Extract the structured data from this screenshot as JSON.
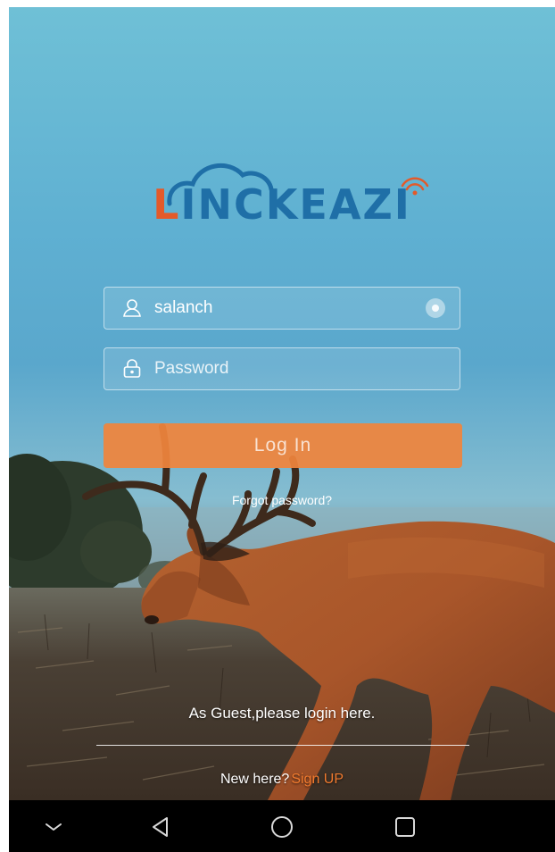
{
  "logo": {
    "text_first": "L",
    "text_rest": "INCKEAZI"
  },
  "login_form": {
    "username_value": "salanch",
    "password_placeholder": "Password",
    "login_label": "Log  In",
    "forgot_label": "Forgot password?"
  },
  "guest": {
    "label": "As Guest,please login here."
  },
  "signup": {
    "prompt": "New here?",
    "link_label": "Sign UP"
  },
  "navbar": {
    "items": [
      "back-icon",
      "back-triangle-icon",
      "home-circle-icon",
      "recents-square-icon"
    ]
  },
  "colors": {
    "accent_orange": "#f07a2e",
    "logo_blue": "#1f6fa7",
    "logo_red": "#e35a2a"
  }
}
